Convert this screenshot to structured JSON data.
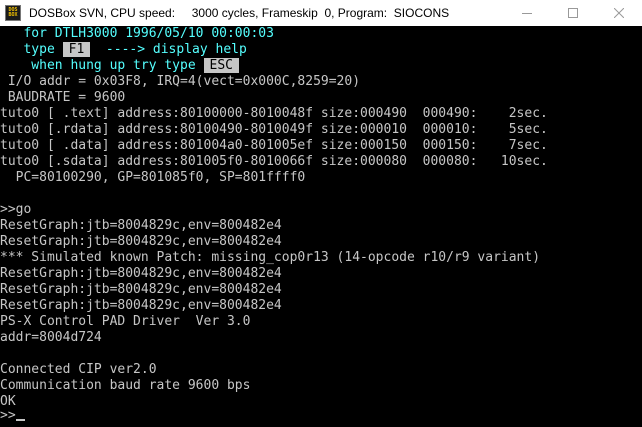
{
  "window": {
    "icon_top": "DOS",
    "icon_bottom": "BOX",
    "title": "DOSBox SVN, CPU speed:     3000 cycles, Frameskip  0, Program:  SIOCONS"
  },
  "console": {
    "header": {
      "for_line": "   for DTLH3000 1996/05/10 00:00:03",
      "help_prefix": "   type ",
      "help_key": "F1",
      "help_suffix": "  ----> display help",
      "hang_prefix": "    when hung up try type ",
      "hang_key": "ESC"
    },
    "lines": [
      " I/O addr = 0x03F8, IRQ=4(vect=0x000C,8259=20)",
      " BAUDRATE = 9600",
      "tuto0 [ .text] address:80100000-8010048f size:000490  000490:    2sec.",
      "tuto0 [.rdata] address:80100490-8010049f size:000010  000010:    5sec.",
      "tuto0 [ .data] address:801004a0-801005ef size:000150  000150:    7sec.",
      "tuto0 [.sdata] address:801005f0-8010066f size:000080  000080:   10sec.",
      "  PC=80100290, GP=801085f0, SP=801ffff0",
      "",
      ">>go",
      "ResetGraph:jtb=8004829c,env=800482e4",
      "ResetGraph:jtb=8004829c,env=800482e4",
      "*** Simulated known Patch: missing_cop0r13 (14-opcode r10/r9 variant)",
      "ResetGraph:jtb=8004829c,env=800482e4",
      "ResetGraph:jtb=8004829c,env=800482e4",
      "ResetGraph:jtb=8004829c,env=800482e4",
      "PS-X Control PAD Driver  Ver 3.0",
      "addr=8004d724",
      "",
      "Connected CIP ver2.0",
      "Communication baud rate 9600 bps",
      "OK"
    ],
    "prompt": ">>"
  }
}
